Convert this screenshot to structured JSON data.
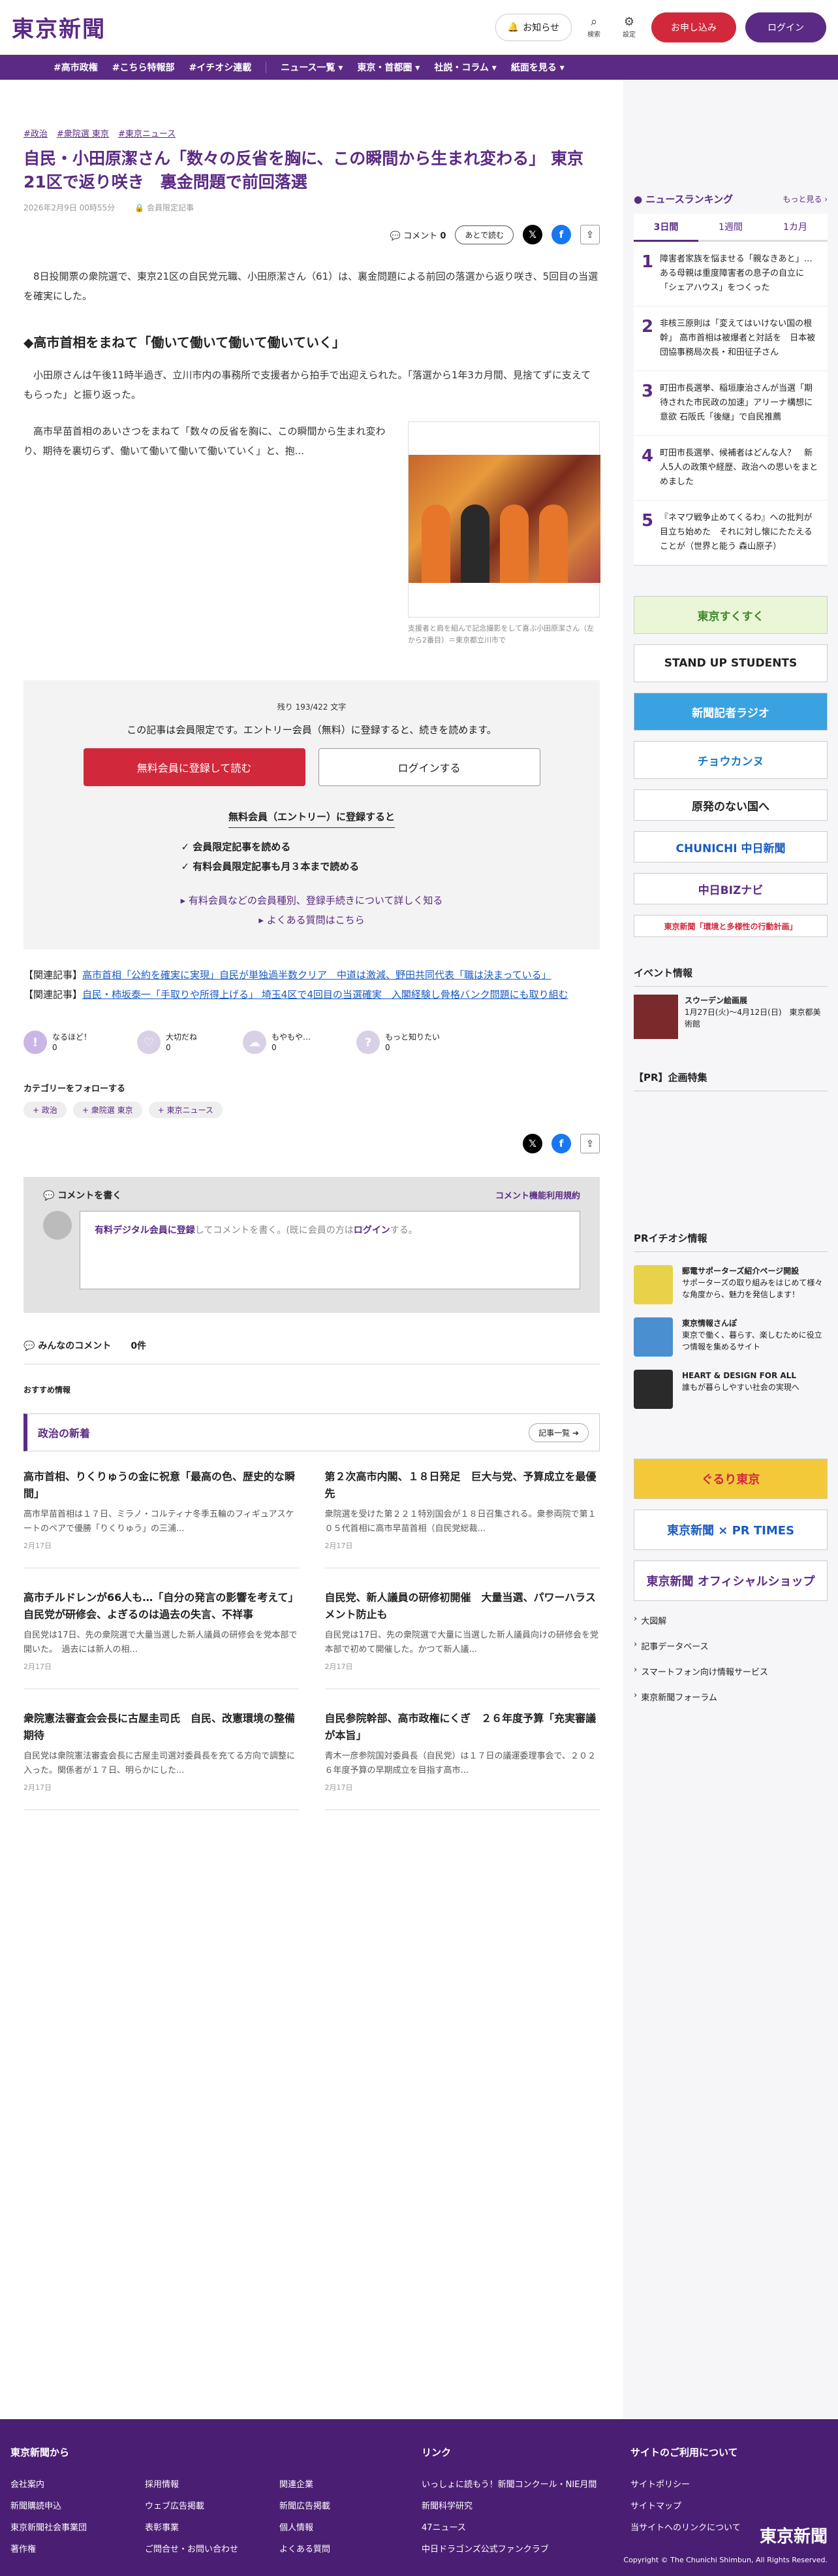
{
  "site": {
    "logo": "東京新聞",
    "notice": "お知らせ",
    "search": "検索",
    "settings": "設定",
    "subscribe": "お申し込み",
    "login": "ログイン"
  },
  "nav": [
    "#高市政権",
    "#こちら特報部",
    "#イチオシ連載",
    "ニュース一覧",
    "東京・首都圏",
    "社説・コラム",
    "紙面を見る"
  ],
  "article": {
    "tags": [
      "#政治",
      "#衆院選 東京",
      "#東京ニュース"
    ],
    "title": "自民・小田原潔さん「数々の反省を胸に、この瞬間から生まれ変わる」 東京21区で返り咲き　裏金問題で前回落選",
    "date": "2026年2月9日 00時55分",
    "members": "会員限定記事",
    "comment_label": "コメント",
    "comment_count": "0",
    "save": "あとで読む",
    "lead": "8日投開票の衆院選で、東京21区の自民党元職、小田原潔さん（61）は、裏金問題による前回の落選から返り咲き、5回目の当選を確実にした。",
    "h2": "◆高市首相をまねて「働いて働いて働いて働いていく」",
    "p2": "小田原さんは午後11時半過ぎ、立川市内の事務所で支援者から拍手で出迎えられた。「落選から1年3カ月間、見捨てずに支えてもらった」と振り返った。",
    "p3": "高市早苗首相のあいさつをまねて「数々の反省を胸に、この瞬間から生まれ変わり、期待を裏切らず、働いて働いて働いて働いていく」と、抱...",
    "caption": "支援者と肩を組んで記念撮影をして喜ぶ小田原潔さん（左から2番目）＝東京都立川市で"
  },
  "paywall": {
    "remain": "残り 193/422 文字",
    "msg": "この記事は会員限定です。エントリー会員（無料）に登録すると、続きを読めます。",
    "free": "無料会員に登録して読む",
    "login": "ログインする",
    "benefit_h": "無料会員（エントリー）に登録すると",
    "benefits": [
      "✓ 会員限定記事を読める",
      "✓ 有料会員限定記事も月３本まで読める"
    ],
    "link1": "有料会員などの会員種別、登録手続きについて詳しく知る",
    "link2": "よくある質問はこちら"
  },
  "related": [
    {
      "k": "【関連記事】",
      "t": "高市首相「公約を確実に実現」自民が単独過半数クリア　中道は激減、野田共同代表「職は決まっている」"
    },
    {
      "k": "【関連記事】",
      "t": "自民・柿坂泰一「手取りや所得上げる」 埼玉4区で4回目の当選確実　入閣経験し骨格バンク問題にも取り組む"
    }
  ],
  "reactions": [
    {
      "l": "なるほど！",
      "n": "0"
    },
    {
      "l": "大切だね",
      "n": "0"
    },
    {
      "l": "もやもや…",
      "n": "0"
    },
    {
      "l": "もっと知りたい",
      "n": "0"
    }
  ],
  "follow": {
    "h": "カテゴリーをフォローする",
    "chips": [
      "政治",
      "衆院選 東京",
      "東京ニュース"
    ]
  },
  "comments": {
    "h": "コメントを書く",
    "rule": "コメント機能利用規約",
    "input_a": "有料デジタル会員に登録",
    "input_b": "してコメントを書く。(既に会員の方は",
    "input_c": "ログイン",
    "input_d": "する。",
    "all": "みんなのコメント",
    "count": "0件"
  },
  "rec": "おすすめ情報",
  "section": {
    "title": "政治の新着",
    "more": "記事一覧"
  },
  "articles": [
    {
      "h": "高市首相、りくりゅうの金に祝意「最高の色、歴史的な瞬間」",
      "b": "高市早苗首相は１７日、ミラノ・コルティナ冬季五輪のフィギュアスケートのペアで優勝「りくりゅう」の三浦...",
      "d": "2月17日"
    },
    {
      "h": "第２次高市内閣、１８日発足　巨大与党、予算成立を最優先",
      "b": "衆院選を受けた第２２１特別国会が１８日召集される。衆参両院で第１０５代首相に高市早苗首相（自民党総裁...",
      "d": "2月17日"
    },
    {
      "h": "高市チルドレンが66人も…「自分の発言の影響を考えて」自民党が研修会、よぎるのは過去の失言、不祥事",
      "b": "自民党は17日、先の衆院選で大量当選した新人議員の研修会を党本部で開いた。　過去には新人の相...",
      "d": "2月17日"
    },
    {
      "h": "自民党、新人議員の研修初開催　大量当選、パワーハラスメント防止も",
      "b": "自民党は17日、先の衆院選で大量に当選した新人議員向けの研修会を党本部で初めて開催した。かつて新人議...",
      "d": "2月17日"
    },
    {
      "h": "衆院憲法審査会会長に古屋圭司氏　自民、改憲環境の整備期待",
      "b": "自民党は衆院憲法審査会長に古屋圭司選対委員長を充てる方向で調整に入った。関係者が１７日、明らかにした...",
      "d": "2月17日"
    },
    {
      "h": "自民参院幹部、高市政権にくぎ　２６年度予算「充実審議が本旨」",
      "b": "青木一彦参院国対委員長（自民党）は１７日の議運委理事会で、２０２６年度予算の早期成立を目指す高市...",
      "d": "2月17日"
    }
  ],
  "sidebar": {
    "ranking_h": "ニュースランキング",
    "ranking_more": "もっと見る",
    "tabs": [
      "3日間",
      "1週間",
      "1カ月"
    ],
    "ranks": [
      {
        "n": "1",
        "t": "障害者家族を悩ませる「親なきあと」…ある母親は重度障害者の息子の自立に「シェアハウス」をつくった"
      },
      {
        "n": "2",
        "t": "非核三原則は「変えてはいけない国の根幹」 高市首相は被爆者と対話を　日本被団協事務局次長・和田征子さん"
      },
      {
        "n": "3",
        "t": "町田市長選挙、稲垣康治さんが当選「期待された市民政の加速」アリーナ構想に意欲 石阪氏「後継」で自民推薦"
      },
      {
        "n": "4",
        "t": "町田市長選挙、候補者はどんな人？　新人5人の政策や経歴、政治への思いをまとめました"
      },
      {
        "n": "5",
        "t": "『ネマワ戦争止めてくるわ』への批判が目立ち始めた　それに対し懐にたたえることが（世界と能う 森山原子）"
      }
    ],
    "banners": [
      "東京すくすく",
      "STAND UP STUDENTS",
      "新聞記者ラジオ",
      "チョウカンヌ",
      "原発のない国へ",
      "CHUNICHI 中日新聞",
      "中日BIZナビ",
      "東京新聞「環境と多様性の行動計画」"
    ],
    "event_h": "イベント情報",
    "event": {
      "t": "スウーデン絵画展",
      "d": "1月27日(火)〜4月12日(日)　東京都美術館"
    },
    "pr_h": "【PR】企画特集",
    "pri_h": "PRイチオシ情報",
    "pri": [
      {
        "t": "郵電サポーターズ紹介ページ開設",
        "b": "サポーターズの取り組みをはじめて様々な角度から、魅力を発信します！"
      },
      {
        "t": "東京情報さんぽ",
        "b": "東京で働く、暮らす、楽しむために役立つ情報を集めるサイト"
      },
      {
        "t": "HEART & DESIGN FOR ALL",
        "b": "誰もが暮らしやすい社会の実現へ"
      }
    ],
    "banners2": [
      "ぐるり東京",
      "東京新聞 × PR TIMES",
      "東京新聞 オフィシャルショップ"
    ],
    "links": [
      "大図解",
      "記事データベース",
      "スマートフォン向け情報サービス",
      "東京新聞フォーラム"
    ]
  },
  "footer": {
    "h1": "東京新聞から",
    "c1": [
      "会社案内",
      "採用情報",
      "関連企業",
      "新聞購読申込",
      "ウェブ広告掲載",
      "新聞広告掲載",
      "東京新聞社会事業団",
      "表彰事業",
      "個人情報",
      "著作権",
      "ご問合せ・お問い合わせ",
      "よくある質問"
    ],
    "h2": "リンク",
    "c2": [
      "いっしょに読もう！新聞コンクール・NIE月間",
      "新聞科学研究",
      "47ニュース",
      "中日ドラゴンズ公式ファンクラブ"
    ],
    "h3": "サイトのご利用について",
    "c3": [
      "サイトポリシー",
      "サイトマップ",
      "当サイトへのリンクについて"
    ],
    "logo": "東京新聞",
    "copy": "Copyright © The Chunichi Shimbun, All Rights Reserved."
  }
}
